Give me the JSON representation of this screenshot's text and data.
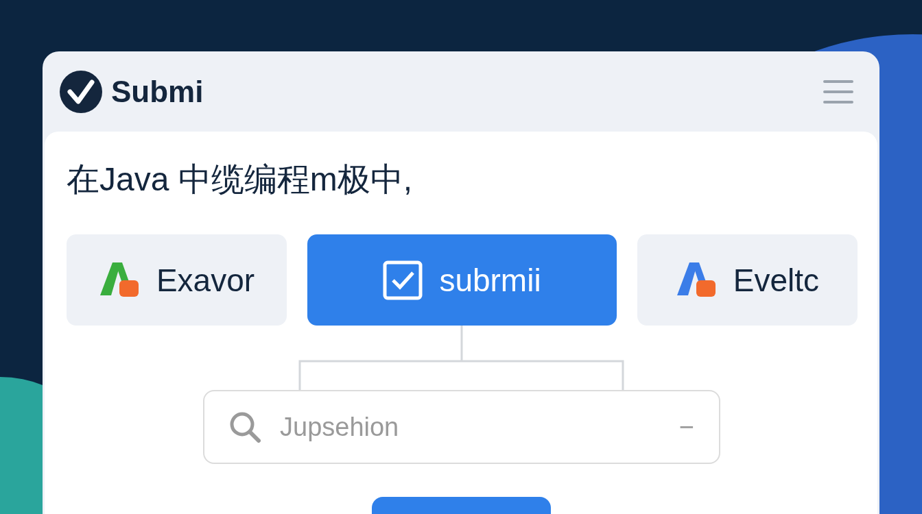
{
  "app": {
    "brand": "Submi"
  },
  "intro": "在Java 中缆编程m极中,",
  "options": [
    {
      "kind": "logo",
      "label": "Exavor",
      "color": "#3aae3e",
      "selected": false
    },
    {
      "kind": "checkbox",
      "label": "subrmii",
      "selected": true
    },
    {
      "kind": "logo",
      "label": "Eveltc",
      "color": "#3b7de8",
      "selected": false
    }
  ],
  "search": {
    "placeholder": "Jupsehion",
    "trailing": "−"
  }
}
